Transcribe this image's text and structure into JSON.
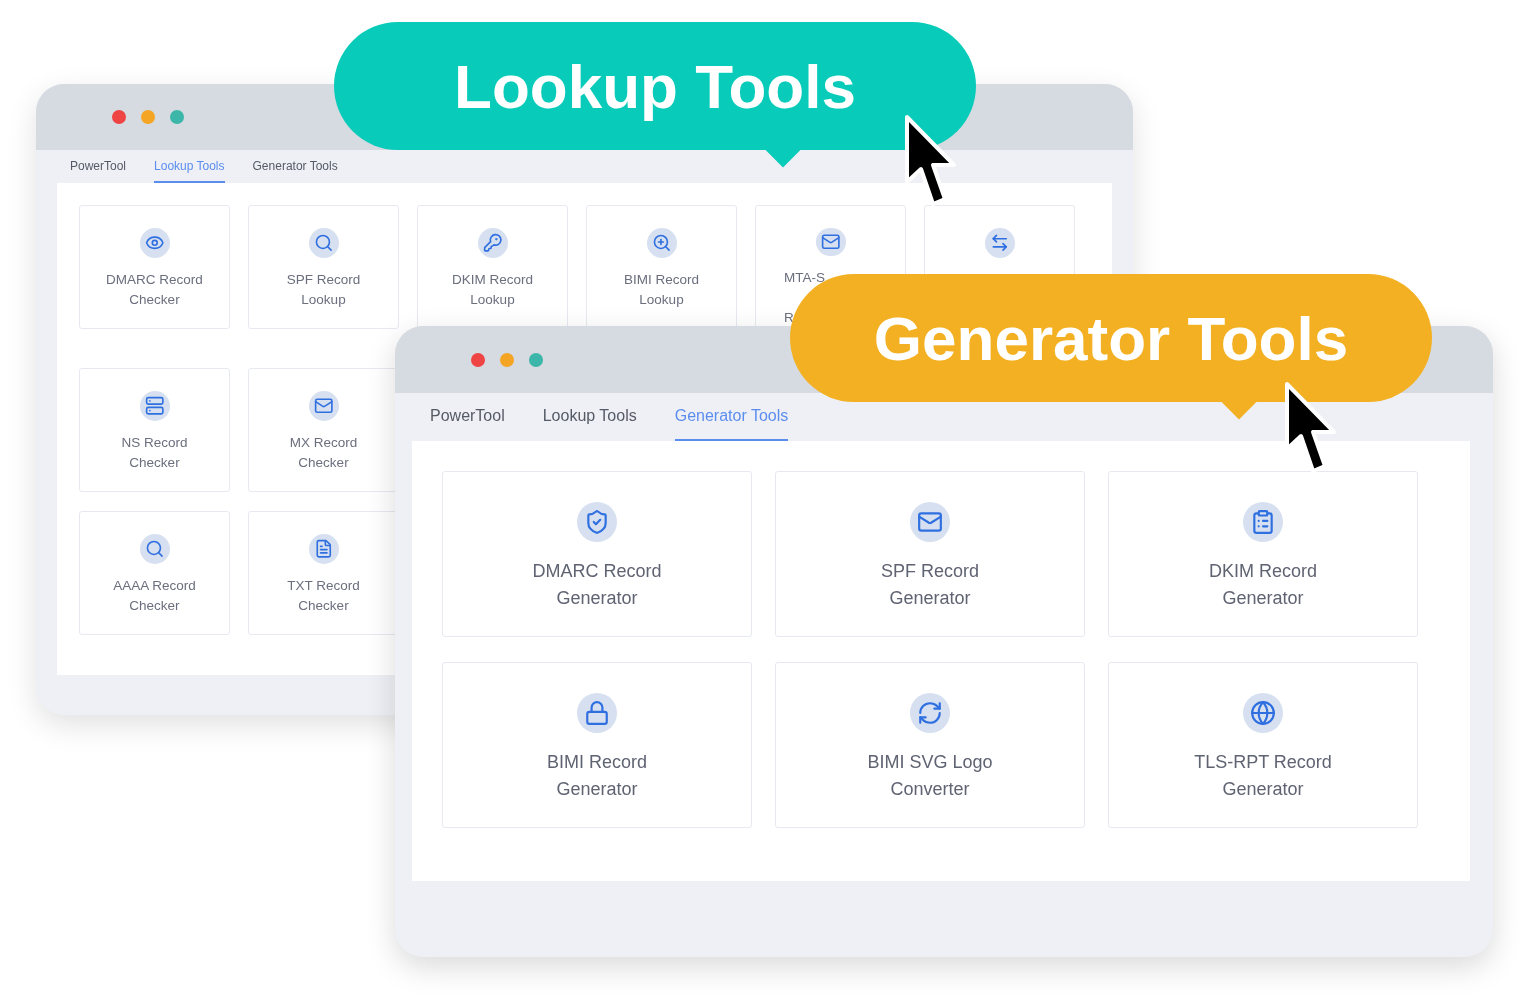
{
  "lookup_window": {
    "tabs": [
      {
        "label": "PowerTool",
        "selected": false
      },
      {
        "label": "Lookup Tools",
        "selected": true
      },
      {
        "label": "Generator Tools",
        "selected": false
      }
    ],
    "rows": [
      [
        {
          "kind": "full",
          "lines": [
            "DMARC Record",
            "Checker"
          ]
        },
        {
          "kind": "full",
          "lines": [
            "SPF Record",
            "Lookup"
          ]
        },
        {
          "kind": "full",
          "lines": [
            "DKIM Record",
            "Lookup"
          ]
        },
        {
          "kind": "full",
          "lines": [
            "BIMI Record",
            "Lookup"
          ]
        },
        {
          "kind": "partly_hidden",
          "lines": [
            "MTA-S",
            "R"
          ]
        },
        {
          "kind": "full"
        }
      ],
      [
        {
          "kind": "full",
          "lines": [
            "NS Record",
            "Checker"
          ]
        },
        {
          "kind": "full",
          "lines": [
            "MX Record",
            "Checker"
          ]
        }
      ],
      [
        {
          "kind": "full",
          "lines": [
            "AAAA Record",
            "Checker"
          ]
        },
        {
          "kind": "full",
          "lines": [
            "TXT Record",
            "Checker"
          ]
        }
      ]
    ]
  },
  "generator_window": {
    "tabs": [
      {
        "label": "PowerTool",
        "selected": false
      },
      {
        "label": "Lookup Tools",
        "selected": false
      },
      {
        "label": "Generator Tools",
        "selected": true
      }
    ],
    "cards": [
      {
        "lines": [
          "DMARC Record",
          "Generator"
        ]
      },
      {
        "lines": [
          "SPF Record",
          "Generator"
        ]
      },
      {
        "lines": [
          "DKIM Record",
          "Generator"
        ]
      },
      {
        "lines": [
          "BIMI Record",
          "Generator"
        ]
      },
      {
        "lines": [
          "BIMI SVG Logo",
          "Converter"
        ]
      },
      {
        "lines": [
          "TLS-RPT Record",
          "Generator"
        ]
      }
    ]
  },
  "callouts": [
    {
      "label": "Lookup Tools",
      "color": "#08cbb9"
    },
    {
      "label": "Generator Tools",
      "color": "#f3b022"
    }
  ]
}
